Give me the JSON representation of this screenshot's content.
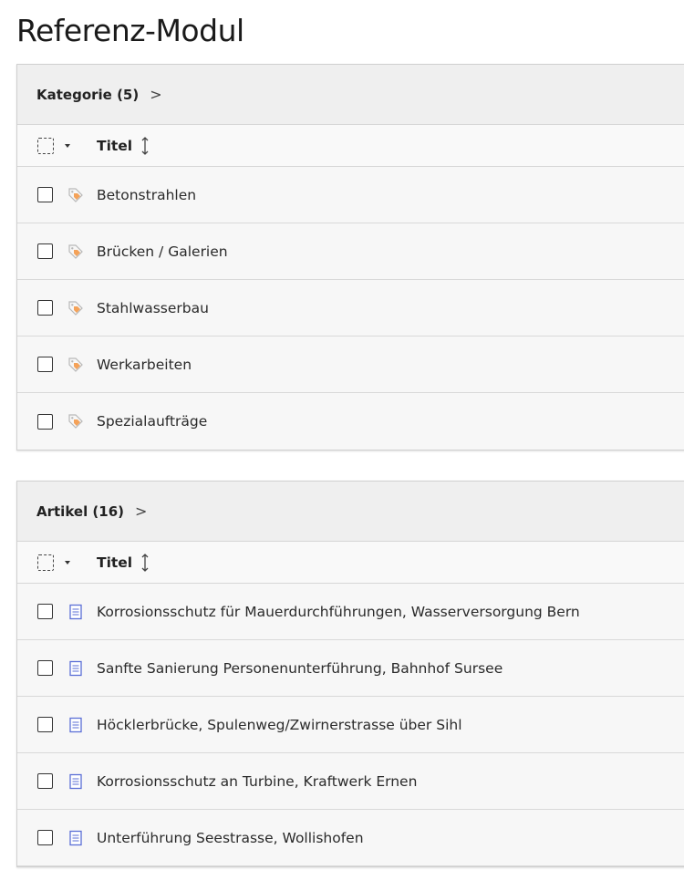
{
  "page": {
    "title": "Referenz-Modul"
  },
  "category_panel": {
    "header": "Kategorie (5)",
    "chevron": ">",
    "column_title": "Titel",
    "icon": "tag-icon",
    "icon_colors": {
      "fill": "#f4a259",
      "stroke": "#b8b8b8"
    },
    "items": [
      {
        "label": "Betonstrahlen"
      },
      {
        "label": "Brücken / Galerien"
      },
      {
        "label": "Stahlwasserbau"
      },
      {
        "label": "Werkarbeiten"
      },
      {
        "label": "Spezialaufträge"
      }
    ]
  },
  "article_panel": {
    "header": "Artikel (16)",
    "chevron": ">",
    "column_title": "Titel",
    "icon": "document-icon",
    "icon_colors": {
      "stroke": "#5b6fd6"
    },
    "items": [
      {
        "label": "Korrosionsschutz für Mauerdurchführungen, Wasserversorgung Bern"
      },
      {
        "label": "Sanfte Sanierung Personenunterführung, Bahnhof Sursee"
      },
      {
        "label": "Höcklerbrücke, Spulenweg/Zwirnerstrasse über Sihl"
      },
      {
        "label": "Korrosionsschutz an Turbine, Kraftwerk Ernen"
      },
      {
        "label": "Unterführung Seestrasse, Wollishofen"
      }
    ]
  }
}
